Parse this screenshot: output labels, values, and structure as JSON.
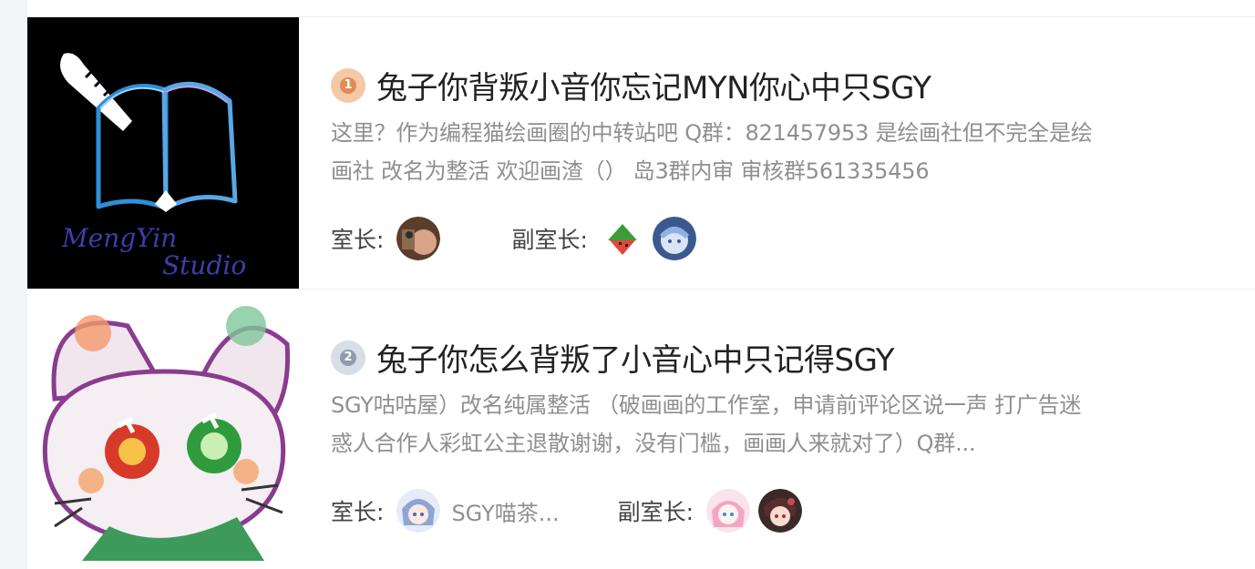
{
  "studios": [
    {
      "rank": "1",
      "rank_color": "#e79a6a",
      "title": "兔子你背叛小音你忘记MYN你心中只SGY",
      "description_line1": "这里？作为编程猫绘画圈的中转站吧 Q群：821457953 是绘画社但不完全是绘",
      "description_line2": "画社 改名为整活 欢迎画渣（） 岛3群内审 审核群561335456",
      "owner_label": "室长:",
      "owner_name": "",
      "deputy_label": "副室长:",
      "cover_text_line1": "MengYin",
      "cover_text_line2": "Studio"
    },
    {
      "rank": "2",
      "rank_color": "#9aa8b8",
      "title": "兔子你怎么背叛了小音心中只记得SGY",
      "description_line1": "SGY咕咕屋）改名纯属整活 （破画画的工作室，申请前评论区说一声 打广告迷",
      "description_line2": "惑人合作人彩虹公主退散谢谢，没有门槛，画画人来就对了）Q群...",
      "owner_label": "室长:",
      "owner_name": "SGY喵茶...",
      "deputy_label": "副室长:"
    }
  ]
}
